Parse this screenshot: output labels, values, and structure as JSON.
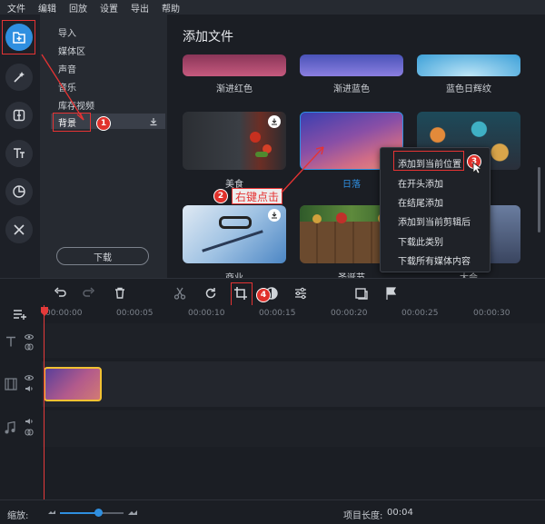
{
  "menubar": {
    "items": [
      "文件",
      "编辑",
      "回放",
      "设置",
      "导出",
      "帮助"
    ]
  },
  "left_toolbar": {
    "tools": [
      "import-media-icon",
      "magic-wand-icon",
      "transitions-icon",
      "text-icon",
      "stickers-icon",
      "tools-icon"
    ]
  },
  "side_menu": {
    "items": [
      "导入",
      "媒体区",
      "声音",
      "音乐",
      "库存视频",
      "背景"
    ],
    "selected": "背景",
    "download_button": "下载"
  },
  "content": {
    "title": "添加文件",
    "thumbnails": [
      {
        "label": "渐进红色"
      },
      {
        "label": "渐进蓝色"
      },
      {
        "label": "蓝色日辉纹"
      },
      {
        "label": "美食"
      },
      {
        "label": "日落"
      },
      {
        "label": ""
      },
      {
        "label": "商业"
      },
      {
        "label": "圣诞节"
      },
      {
        "label": "大会"
      }
    ]
  },
  "context_menu": {
    "items": [
      "添加到当前位置",
      "在开头添加",
      "在结尾添加",
      "添加到当前剪辑后",
      "下载此类别",
      "下载所有媒体内容"
    ]
  },
  "callouts": {
    "n1": "1",
    "n2": "2",
    "n3": "3",
    "n4": "4",
    "right_click": "右键点击"
  },
  "toolbar": {
    "icons": [
      "undo-icon",
      "redo-icon",
      "delete-icon",
      "cut-icon",
      "rotate-icon",
      "crop-icon",
      "color-icon",
      "adjust-icon",
      "clip-properties-icon",
      "marker-icon"
    ]
  },
  "timeline": {
    "ticks": [
      "00:00:00",
      "00:00:05",
      "00:00:10",
      "00:00:15",
      "00:00:20",
      "00:00:25",
      "00:00:30"
    ]
  },
  "status": {
    "zoom_label": "缩放:",
    "project_length_label": "项目长度:",
    "project_length_value": "00:04",
    "zoom_level": 0.6
  },
  "colors": {
    "accent": "#2f8fe0",
    "highlight_red": "#e53333",
    "clip_border": "#f2c132"
  }
}
